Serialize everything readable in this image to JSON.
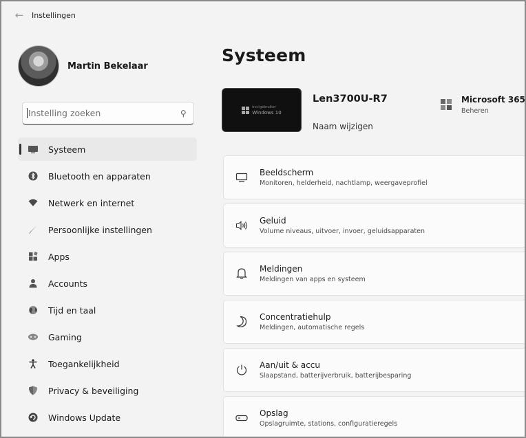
{
  "window": {
    "title": "Instellingen",
    "back_glyph": "←"
  },
  "profile": {
    "name": "Martin Bekelaar"
  },
  "search": {
    "placeholder": "Instelling zoeken",
    "icon": "search-icon"
  },
  "sidebar": {
    "items": [
      {
        "label": "Systeem",
        "icon": "monitor-icon",
        "active": true
      },
      {
        "label": "Bluetooth en apparaten",
        "icon": "bluetooth-icon"
      },
      {
        "label": "Netwerk en internet",
        "icon": "wifi-icon"
      },
      {
        "label": "Persoonlijke instellingen",
        "icon": "brush-icon"
      },
      {
        "label": "Apps",
        "icon": "apps-icon"
      },
      {
        "label": "Accounts",
        "icon": "person-icon"
      },
      {
        "label": "Tijd en taal",
        "icon": "globe-icon"
      },
      {
        "label": "Gaming",
        "icon": "gamepad-icon"
      },
      {
        "label": "Toegankelijkheid",
        "icon": "accessibility-icon"
      },
      {
        "label": "Privacy & beveiliging",
        "icon": "shield-icon"
      },
      {
        "label": "Windows Update",
        "icon": "update-icon"
      }
    ]
  },
  "main": {
    "title": "Systeem",
    "device": {
      "name": "Len3700U-R7",
      "rename_label": "Naam wijzigen",
      "thumb_brand": "hcc!gebruiker",
      "thumb_os": "Windows 10"
    },
    "ms365": {
      "title": "Microsoft 365",
      "subtitle": "Beheren"
    },
    "cards": [
      {
        "title": "Beeldscherm",
        "subtitle": "Monitoren, helderheid, nachtlamp, weergaveprofiel",
        "icon": "display-icon"
      },
      {
        "title": "Geluid",
        "subtitle": "Volume niveaus, uitvoer, invoer, geluidsapparaten",
        "icon": "speaker-icon"
      },
      {
        "title": "Meldingen",
        "subtitle": "Meldingen van apps en systeem",
        "icon": "bell-icon"
      },
      {
        "title": "Concentratiehulp",
        "subtitle": "Meldingen, automatische regels",
        "icon": "moon-icon"
      },
      {
        "title": "Aan/uit & accu",
        "subtitle": "Slaapstand, batterijverbruik, batterijbesparing",
        "icon": "power-icon"
      },
      {
        "title": "Opslag",
        "subtitle": "Opslagruimte, stations, configuratieregels",
        "icon": "storage-icon"
      }
    ]
  }
}
